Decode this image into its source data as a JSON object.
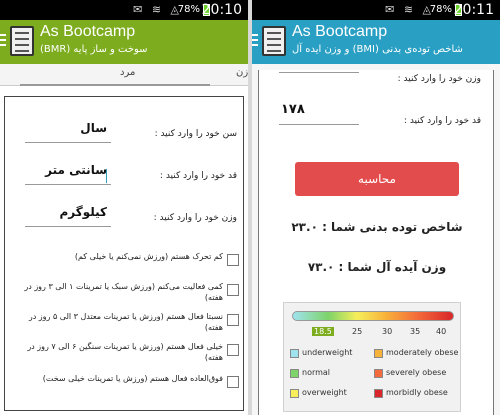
{
  "left": {
    "status": {
      "icons": "✉ ≋ ◬",
      "battery": "78%",
      "time": "20:10"
    },
    "app": {
      "title": "As Bootcamp",
      "subtitle": "سوخت و ساز پایه (BMR)"
    },
    "tabs": [
      {
        "label": "مرد"
      },
      {
        "label": "زن"
      }
    ],
    "form": {
      "fields": [
        {
          "label": "سن خود را وارد کنید :",
          "value": "سال"
        },
        {
          "label": "قد خود را وارد کنید :",
          "value": "سانتی متر"
        },
        {
          "label": "وزن خود را وارد کنید :",
          "value": "کیلوگرم"
        }
      ],
      "activities": [
        {
          "label": "کم تحرک هستم (ورزش نمی‌کنم یا خیلی کم)"
        },
        {
          "label": "کمی فعالیت می‌کنم (ورزش سبک یا تمرینات ۱ الی ۳ روز در هفته)"
        },
        {
          "label": "نسبتا فعال هستم (ورزش یا تمرینات معتدل ۳ الی ۵ روز در هفته)"
        },
        {
          "label": "خیلی فعال هستم (ورزش یا تمرینات سنگین ۶ الی ۷ روز در هفته)"
        },
        {
          "label": "فوق‌العاده فعال هستم (ورزش یا تمرینات خیلی سخت)"
        }
      ]
    }
  },
  "right": {
    "status": {
      "icons": "✉ ≋ ◬",
      "battery": "78%",
      "time": "20:11"
    },
    "app": {
      "title": "As Bootcamp",
      "subtitle": "شاخص توده‌ی بدنی (BMI) و وزن ایده آل"
    },
    "weight_label": "وزن خود را وارد کنید :",
    "height_label": "قد خود را وارد کنید :",
    "height_value": "۱۷۸",
    "calculate_label": "محاسبه",
    "bmi_result": "شاخص توده بدنی شما :  ۲۳.۰",
    "ideal_weight": "وزن آیده آل شما :  ۷۳.۰",
    "scale": {
      "ticks": [
        "18.5",
        "25",
        "30",
        "35",
        "40"
      ],
      "legend": [
        {
          "label": "underweight",
          "color": "#9fe3ee"
        },
        {
          "label": "moderately obese",
          "color": "#f7b23a"
        },
        {
          "label": "normal",
          "color": "#7ed36a"
        },
        {
          "label": "severely obese",
          "color": "#f46a3a"
        },
        {
          "label": "overweight",
          "color": "#f6ee5a"
        },
        {
          "label": "morbidly obese",
          "color": "#d8262a"
        }
      ]
    }
  }
}
